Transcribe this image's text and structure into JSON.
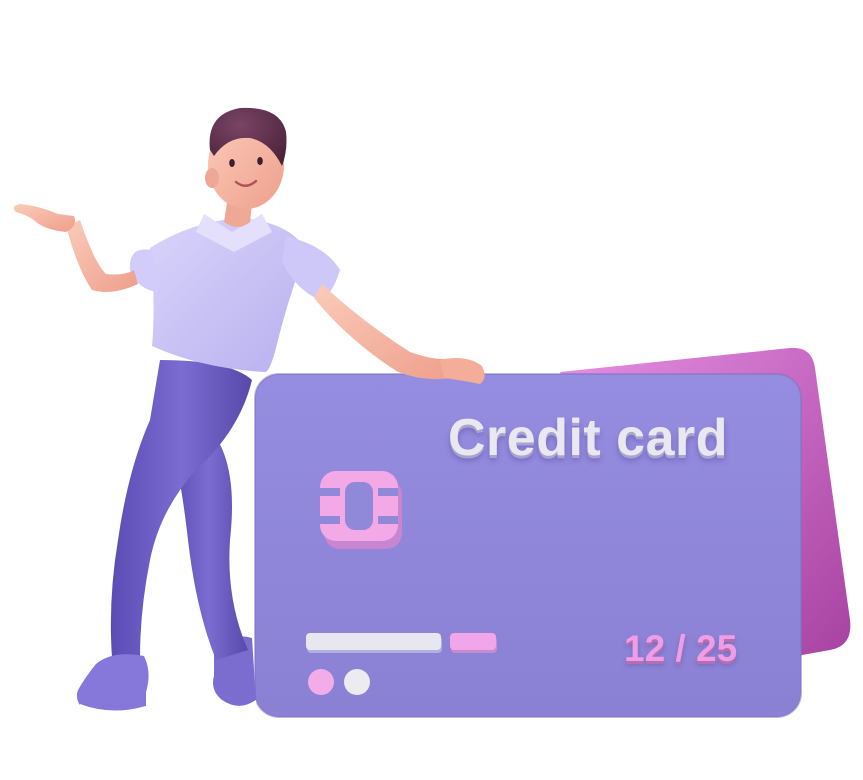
{
  "card": {
    "title": "Credit card",
    "expiry": "12 / 25"
  },
  "colors": {
    "card_front": "#9088d9",
    "card_back": "#c66fcf",
    "chip": "#f2a9e6",
    "stripe_light": "#e8e6ee",
    "stripe_pink": "#f0a6e8",
    "shirt": "#c8c2f4",
    "pants": "#6c5ec2",
    "shoes": "#8678db",
    "hair": "#5a2f4a",
    "skin": "#f6b9a6"
  },
  "icons": [
    "person-illustration",
    "credit-card-illustration",
    "card-chip-icon"
  ]
}
